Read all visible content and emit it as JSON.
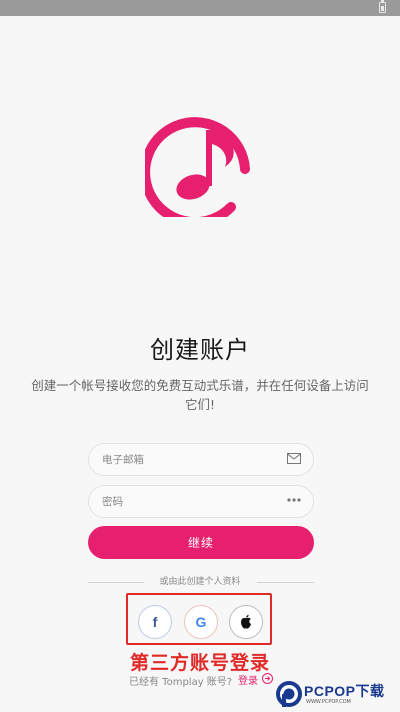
{
  "header": {
    "title": "创建账户",
    "subtitle": "创建一个帐号接收您的免费互动式乐谱，并在任何设备上访问它们!"
  },
  "form": {
    "email_placeholder": "电子邮箱",
    "password_placeholder": "密码",
    "continue_label": "继续"
  },
  "divider": {
    "text": "或由此创建个人资料"
  },
  "social": {
    "facebook_glyph": "f",
    "google_glyph": "G",
    "apple_glyph": ""
  },
  "annotation": {
    "text": "第三方账号登录"
  },
  "footer": {
    "existing_text": "已经有 Tomplay 账号?",
    "login_label": "登录"
  },
  "watermark": {
    "brand": "PCPOP下载",
    "sub": "WWW.PCPOP.COM"
  },
  "colors": {
    "accent": "#e61f6e",
    "annotation": "#e02a2a",
    "facebook": "#3b5998"
  },
  "icons": {
    "logo": "music-note-logo",
    "email": "mail-icon",
    "password": "dots-icon",
    "login_arrow": "arrow-right-circle-icon"
  }
}
